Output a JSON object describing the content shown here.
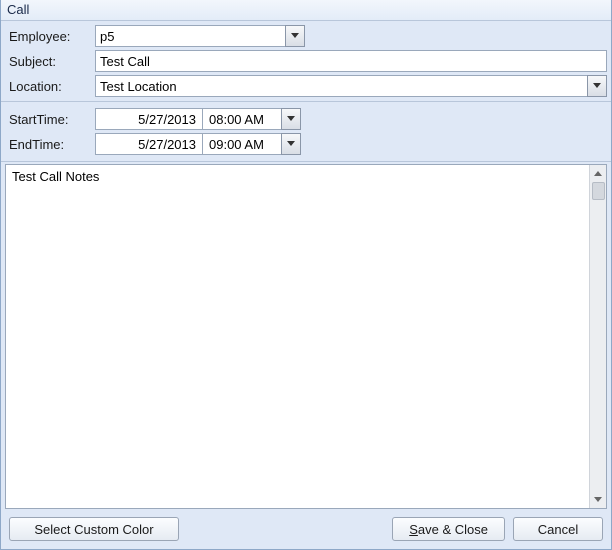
{
  "title": "Call",
  "labels": {
    "employee": "Employee:",
    "subject": "Subject:",
    "location": "Location:",
    "startTime": "StartTime:",
    "endTime": "EndTime:"
  },
  "fields": {
    "employee": "p5",
    "subject": "Test Call",
    "location": "Test Location",
    "startDate": "5/27/2013",
    "startTime": "08:00 AM",
    "endDate": "5/27/2013",
    "endTime": "09:00 AM",
    "notes": "Test Call Notes"
  },
  "buttons": {
    "selectColor": "Select Custom Color",
    "saveCloseFull": "Save & Close",
    "cancel": "Cancel"
  }
}
